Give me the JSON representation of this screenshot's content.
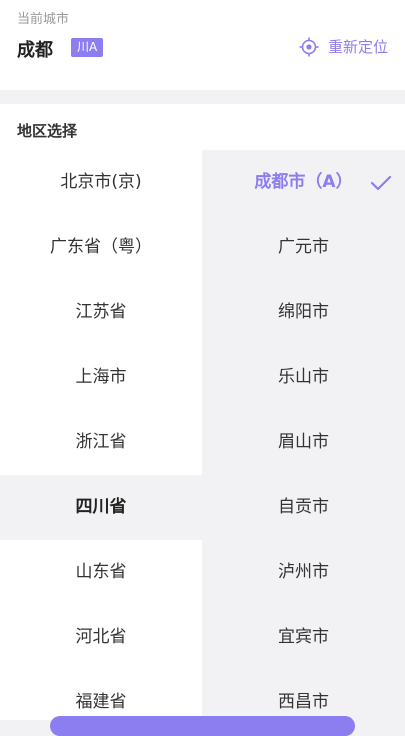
{
  "current": {
    "label": "当前城市",
    "city": "成都",
    "plate": "川A",
    "relocate_label": "重新定位"
  },
  "region": {
    "header": "地区选择",
    "provinces": [
      "北京市(京)",
      "广东省（粤）",
      "江苏省",
      "上海市",
      "浙江省",
      "四川省",
      "山东省",
      "河北省",
      "福建省"
    ],
    "selected_province": "四川省",
    "cities": [
      "成都市（A）",
      "广元市",
      "绵阳市",
      "乐山市",
      "眉山市",
      "自贡市",
      "泸州市",
      "宜宾市",
      "西昌市"
    ],
    "selected_city": "成都市（A）"
  },
  "colors": {
    "accent": "#8c7df0",
    "background": "#f2f2f4"
  },
  "icons": {
    "relocate": "locate-crosshair-icon",
    "selected": "check-icon"
  }
}
